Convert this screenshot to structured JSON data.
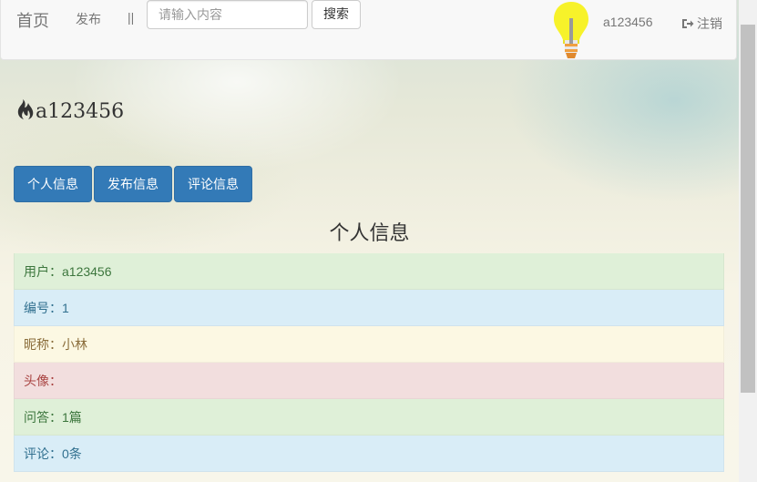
{
  "navbar": {
    "brand": "首页",
    "publish_link": "发布",
    "separator": "||",
    "search": {
      "placeholder": "请输入内容",
      "button_label": "搜索"
    },
    "user_link": "a123456",
    "logout_label": "注销"
  },
  "profile": {
    "username": "a123456"
  },
  "tabs": [
    {
      "label": "个人信息"
    },
    {
      "label": "发布信息"
    },
    {
      "label": "评论信息"
    }
  ],
  "section_title": "个人信息",
  "info_rows": [
    {
      "text": "用户：a123456",
      "style": "success"
    },
    {
      "text": "编号：1",
      "style": "info"
    },
    {
      "text": "昵称：小林",
      "style": "warning"
    },
    {
      "text": "头像：",
      "style": "danger"
    },
    {
      "text": "问答：1篇",
      "style": "success"
    },
    {
      "text": "评论：0条",
      "style": "info"
    }
  ],
  "colors": {
    "primary": "#337ab7",
    "success_bg": "#dff0d8",
    "info_bg": "#d9edf7",
    "warning_bg": "#fcf8e3",
    "danger_bg": "#f2dede"
  }
}
